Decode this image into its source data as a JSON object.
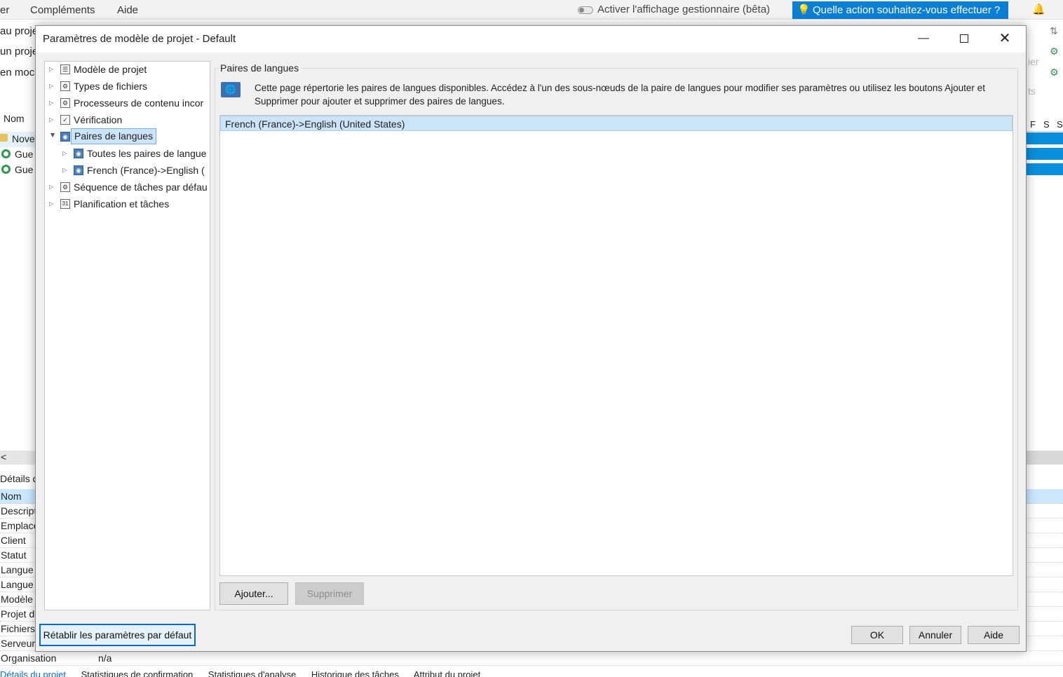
{
  "app": {
    "menu": [
      "er",
      "Compléments",
      "Aide"
    ],
    "beta_toggle_label": "Activer l'affichage gestionnaire (bêta)",
    "ask_box": "Quelle action souhaitez-vous effectuer ?",
    "left_ribbon": [
      "au proje",
      "un proje",
      "en moc"
    ],
    "name_header": "Nom",
    "projects": [
      "Nove",
      "Gue",
      "Gue"
    ],
    "right_faded": [
      "ier",
      "ts"
    ],
    "right_grid_headers": [
      "F",
      "S",
      "S"
    ],
    "details_header": "Détails d",
    "properties": [
      {
        "label": "Nom",
        "value": ""
      },
      {
        "label": "Descripti",
        "value": ""
      },
      {
        "label": "Emplace",
        "value": ""
      },
      {
        "label": "Client",
        "value": ""
      },
      {
        "label": "Statut",
        "value": ""
      },
      {
        "label": "Langue",
        "value": ""
      },
      {
        "label": "Langue",
        "value": ""
      },
      {
        "label": "Modèle",
        "value": ""
      },
      {
        "label": "Projet d",
        "value": ""
      },
      {
        "label": "Fichiers",
        "value": ""
      },
      {
        "label": "Serveur",
        "value": ""
      },
      {
        "label": "Organisation",
        "value": "n/a"
      }
    ],
    "bottom_tabs": [
      "Détails du projet",
      "Statistiques de confirmation",
      "Statistiques d'analyse",
      "Historique des tâches",
      "Attribut du projet"
    ]
  },
  "dialog": {
    "title": "Paramètres de modèle de projet - Default",
    "tree": [
      {
        "label": "Modèle de projet",
        "icon": "doc-icon"
      },
      {
        "label": "Types de fichiers",
        "icon": "file-types-icon"
      },
      {
        "label": "Processeurs de contenu incor",
        "icon": "processor-icon"
      },
      {
        "label": "Vérification",
        "icon": "check-icon"
      },
      {
        "label": "Paires de langues",
        "icon": "language-pair-icon",
        "selected": true
      },
      {
        "label": "Toutes les paires de langue",
        "icon": "language-pair-icon"
      },
      {
        "label": "French (France)->English (",
        "icon": "language-pair-icon"
      },
      {
        "label": "Séquence de tâches par défau",
        "icon": "sequence-icon"
      },
      {
        "label": "Planification et tâches",
        "icon": "calendar-icon"
      }
    ],
    "group_title": "Paires de langues",
    "info": "Cette page répertorie les paires de langues disponibles. Accédez à l'un des sous-nœuds de la paire de langues pour modifier ses paramètres ou utilisez les boutons Ajouter et Supprimer pour ajouter et supprimer des paires de langues.",
    "language_pairs": [
      "French (France)->English (United States)"
    ],
    "buttons": {
      "add": "Ajouter...",
      "remove": "Supprimer",
      "reset": "Rétablir les paramètres par défaut",
      "ok": "OK",
      "cancel": "Annuler",
      "help": "Aide"
    }
  }
}
